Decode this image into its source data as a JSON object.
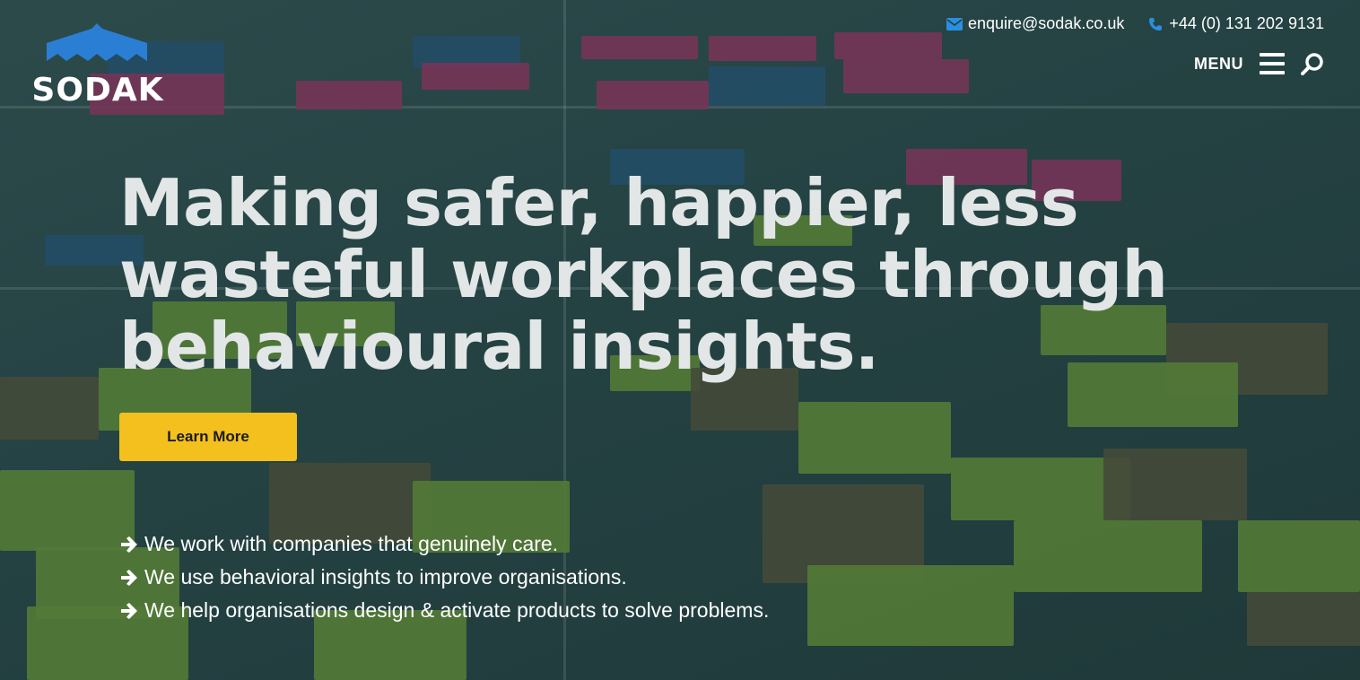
{
  "brand": {
    "name": "SODAK",
    "mark_color": "#2a7fd4"
  },
  "contact": {
    "email": "enquire@sodak.co.uk",
    "phone": "+44 (0) 131 202 9131",
    "icon_color": "#2a8fe0"
  },
  "nav": {
    "menu_label": "MENU"
  },
  "hero": {
    "headline": "Making safer, happier, less wasteful workplaces through behavioural insights.",
    "cta_label": "Learn More",
    "cta_color": "#f4c01e",
    "bullets": [
      "We work with companies that genuinely care.",
      "We use behavioral insights to improve organisations.",
      "We help organisations design & activate products to solve problems."
    ]
  },
  "icons": {
    "logo": "house-roof-icon",
    "email": "envelope-icon",
    "phone": "phone-icon",
    "menu": "hamburger-menu-icon",
    "search": "search-icon",
    "bullet": "arrow-right-icon"
  }
}
